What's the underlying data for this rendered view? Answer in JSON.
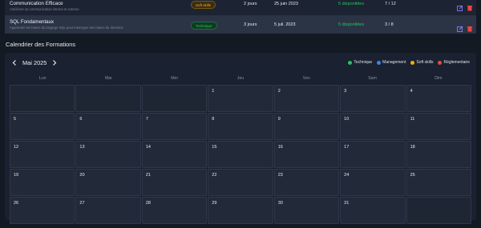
{
  "table": {
    "rows": [
      {
        "name": "Communication Efficace",
        "description": "Améliorer sa communication interne et externe",
        "category": "Soft skills",
        "category_color": "#ffb020",
        "duration": "2 jours",
        "date": "25 juin 2023",
        "availability": "5 disponibles",
        "seats": "7 / 12",
        "highlighted": false
      },
      {
        "name": "SQL Fondamentaux",
        "description": "Apprendre les bases du langage SQL pour interroger des bases de données",
        "category": "Technique",
        "category_color": "#22c55e",
        "duration": "3 jours",
        "date": "5 juil. 2023",
        "availability": "5 disponibles",
        "seats": "3 / 8",
        "highlighted": true
      }
    ],
    "edit_icon": "edit-icon",
    "delete_icon": "trash-icon"
  },
  "calendar": {
    "title": "Calendrier des Formations",
    "month_label": "Mai 2025",
    "weekdays": [
      "Lun",
      "Mar",
      "Mer",
      "Jeu",
      "Ven",
      "Sam",
      "Dim"
    ],
    "legend": [
      {
        "label": "Technique",
        "color": "#22c55e"
      },
      {
        "label": "Management",
        "color": "#3b82f6"
      },
      {
        "label": "Soft skills",
        "color": "#eab308"
      },
      {
        "label": "Réglementaire",
        "color": "#ef4444"
      }
    ],
    "cells": [
      "",
      "",
      "",
      "1",
      "2",
      "3",
      "4",
      "5",
      "6",
      "7",
      "8",
      "9",
      "10",
      "11",
      "12",
      "13",
      "14",
      "15",
      "16",
      "17",
      "18",
      "19",
      "20",
      "21",
      "22",
      "23",
      "24",
      "25",
      "26",
      "27",
      "28",
      "29",
      "30",
      "31",
      ""
    ]
  },
  "colors": {
    "available": "#22c55e",
    "edit": "#8b7cf6",
    "delete": "#ef4444"
  }
}
